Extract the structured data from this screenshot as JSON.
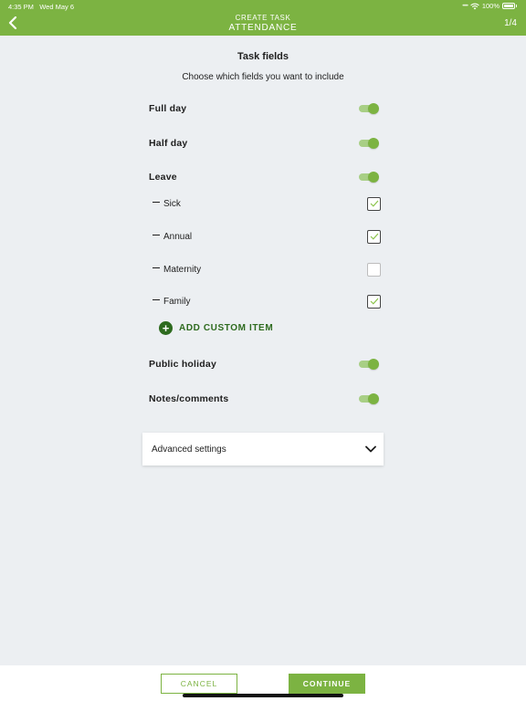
{
  "status_bar": {
    "time": "4:35 PM",
    "date": "Wed May 6",
    "battery": "100%"
  },
  "header": {
    "supertitle": "CREATE TASK",
    "title": "ATTENDANCE",
    "step": "1/4"
  },
  "section": {
    "title": "Task fields",
    "subtitle": "Choose which fields you want to include"
  },
  "fields": {
    "full_day": {
      "label": "Full day",
      "enabled": true
    },
    "half_day": {
      "label": "Half day",
      "enabled": true
    },
    "leave": {
      "label": "Leave",
      "enabled": true
    },
    "public_holiday": {
      "label": "Public holiday",
      "enabled": true
    },
    "notes": {
      "label": "Notes/comments",
      "enabled": true
    }
  },
  "leave_items": [
    {
      "label": "Sick",
      "checked": true
    },
    {
      "label": "Annual",
      "checked": true
    },
    {
      "label": "Maternity",
      "checked": false
    },
    {
      "label": "Family",
      "checked": true
    }
  ],
  "add_custom": {
    "icon": "plus-circle-icon",
    "label": "ADD CUSTOM ITEM"
  },
  "advanced": {
    "label": "Advanced settings",
    "icon": "chevron-down-icon"
  },
  "footer": {
    "cancel_label": "CANCEL",
    "continue_label": "CONTINUE"
  },
  "colors": {
    "accent": "#7cb342",
    "dark_green": "#2e6b1f",
    "background": "#eceff2"
  }
}
